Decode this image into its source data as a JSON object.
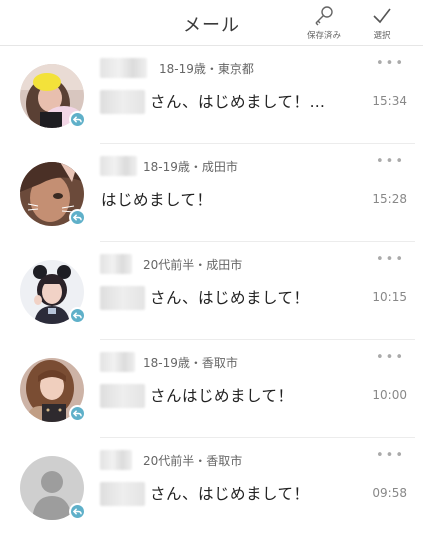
{
  "header": {
    "title": "メール",
    "saved_label": "保存済み",
    "select_label": "選択"
  },
  "messages": [
    {
      "meta": "18-19歳・東京都",
      "message": "さん、はじめまして！…",
      "time": "15:34",
      "more": "•••"
    },
    {
      "meta": "18-19歳・成田市",
      "message": "はじめまして！",
      "time": "15:28",
      "more": "•••"
    },
    {
      "meta": "20代前半・成田市",
      "message": "さん、はじめまして！",
      "time": "10:15",
      "more": "•••"
    },
    {
      "meta": "18-19歳・香取市",
      "message": "さんはじめまして！",
      "time": "10:00",
      "more": "•••"
    },
    {
      "meta": "20代前半・香取市",
      "message": "さん、はじめまして！",
      "time": "09:58",
      "more": "•••"
    }
  ],
  "colors": {
    "badge": "#5fb0c9",
    "separator": "#ececec"
  },
  "icons": {
    "saved": "key-icon",
    "select": "check-icon",
    "badge": "reply-icon"
  }
}
